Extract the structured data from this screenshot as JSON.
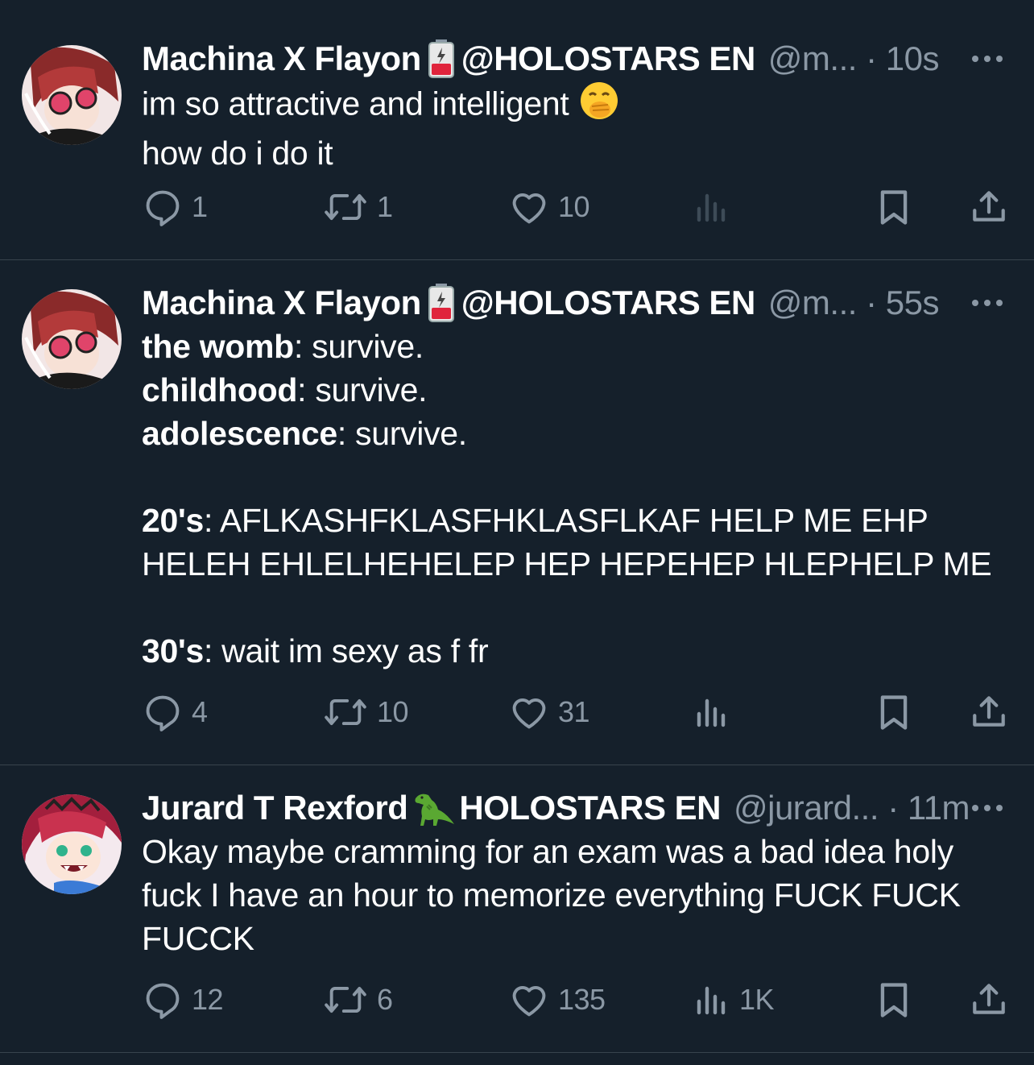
{
  "tweets": [
    {
      "name": "Machina X Flayon",
      "affiliation": "@HOLOSTARS EN",
      "handle": "@m...",
      "time": "10s",
      "lines": [
        "im so attractive and intelligent",
        "how do i do it"
      ],
      "replies": "1",
      "retweets": "1",
      "likes": "10",
      "views": ""
    },
    {
      "name": "Machina X Flayon",
      "affiliation": "@HOLOSTARS EN",
      "handle": "@m...",
      "time": "55s",
      "stanzas": [
        {
          "label": "the womb",
          "text": ": survive."
        },
        {
          "label": "childhood",
          "text": ": survive."
        },
        {
          "label": "adolescence",
          "text": ": survive."
        },
        {
          "label": "20's",
          "text": ": AFLKASHFKLASFHKLASFLKAF HELP ME EHP",
          "cont": "HELEH EHLELHEHELEP HEP HEPEHEP HLEPHELP ME"
        },
        {
          "label": "30's",
          "text": ": wait im sexy as f fr"
        }
      ],
      "replies": "4",
      "retweets": "10",
      "likes": "31",
      "views": ""
    },
    {
      "name": "Jurard T Rexford",
      "affiliation": "HOLOSTARS EN",
      "handle": "@jurard...",
      "time": "11m",
      "lines": [
        "Okay maybe cramming for an exam was a bad idea holy",
        "fuck I have an hour to memorize everything FUCK FUCK",
        "FUCCK"
      ],
      "replies": "12",
      "retweets": "6",
      "likes": "135",
      "views": "1K"
    }
  ],
  "separator": "·",
  "colors": {
    "background": "#15202b",
    "text": "#ffffff",
    "muted": "#8b98a5",
    "divider": "#38444d"
  }
}
